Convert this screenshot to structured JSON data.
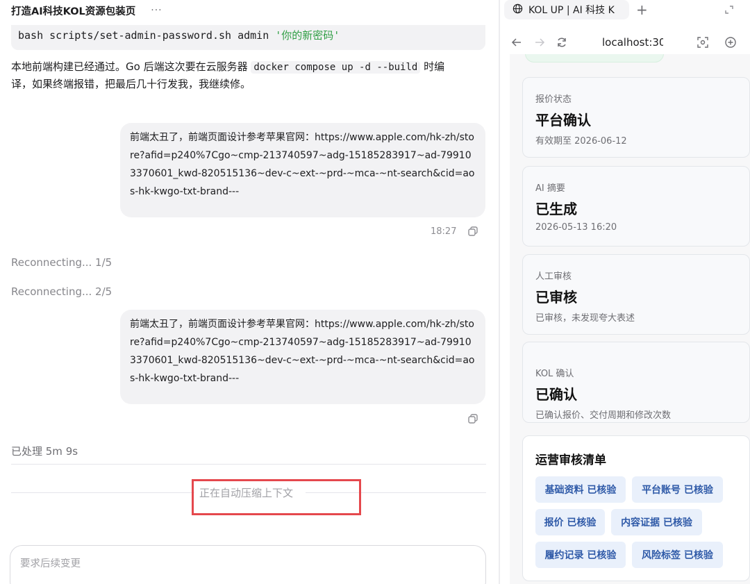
{
  "chat": {
    "title": "打造AI科技KOL资源包装页",
    "more": "···",
    "code": {
      "command": "bash scripts/set-admin-password.sh admin ",
      "argument": "'你的新密码'"
    },
    "assistant": {
      "line1_part1": "本地前端构建已经通过。Go 后端这次要在云服务器 ",
      "line1_code": "docker compose up -d --build",
      "line1_part2": " 时编",
      "line2": "译，如果终端报错，把最后几十行发我，我继续修。"
    },
    "user_message_1": "前端太丑了，前端页面设计参考苹果官网：https://www.apple.com/hk-zh/store?afid=p240%7Cgo~cmp-213740597~adg-15185283917~ad-799103370601_kwd-820515136~dev-c~ext-~prd-~mca-~nt-search&cid=aos-hk-kwgo-txt-brand---",
    "user_message_1_time": "18:27",
    "reconnect_1": "Reconnecting... 1/5",
    "reconnect_2": "Reconnecting... 2/5",
    "user_message_2": "前端太丑了，前端页面设计参考苹果官网：https://www.apple.com/hk-zh/store?afid=p240%7Cgo~cmp-213740597~adg-15185283917~ad-799103370601_kwd-820515136~dev-c~ext-~prd-~mca-~nt-search&cid=aos-hk-kwgo-txt-brand---",
    "processed": "已处理 5m 9s",
    "compressing": "正在自动压缩上下文",
    "composer_placeholder": "要求后续变更",
    "highlight_color": "#e5484d"
  },
  "browser": {
    "tab_title": "KOL UP | AI 科技 K",
    "tab_icon": "globe-icon",
    "new_tab": "+",
    "url": "localhost:30",
    "cards": [
      {
        "label": "报价状态",
        "value": "平台确认",
        "sub": "有效期至 2026-06-12"
      },
      {
        "label": "AI 摘要",
        "value": "已生成",
        "sub": "2026-05-13 16:20"
      },
      {
        "label": "人工审核",
        "value": "已审核",
        "sub": "已审核，未发现夸大表述"
      },
      {
        "label": "KOL 确认",
        "value": "已确认",
        "sub": "已确认报价、交付周期和修改次数"
      }
    ],
    "checklist": {
      "title": "运营审核清单",
      "chips": [
        "基础资料 已核验",
        "平台账号 已核验",
        "报价 已核验",
        "内容证据 已核验",
        "履约记录 已核验",
        "风险标签 已核验"
      ]
    },
    "accent_chip_bg": "#e9f0fb",
    "accent_chip_text": "#2f5aa8"
  }
}
